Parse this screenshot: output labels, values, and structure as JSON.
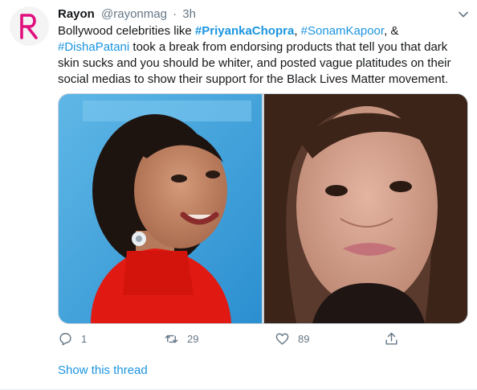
{
  "tweet": {
    "author_name": "Rayon",
    "handle": "@rayonmag",
    "separator": "·",
    "time": "3h",
    "avatar_letter": "R",
    "text": {
      "t1": "Bollywood celebrities like ",
      "tag1": "#PriyankaChopra",
      "t2": ", ",
      "tag2": "#SonamKapoor",
      "t3": ", & ",
      "tag3": "#DishaPatani",
      "t4": " took a break from endorsing products that tell you that dark skin sucks and you should be whiter, and posted vague platitudes on their social medias to show their support for the Black Lives Matter movement."
    },
    "media": [
      {
        "icon": "photo-woman-red-dress"
      },
      {
        "icon": "photo-woman-selfie"
      }
    ],
    "actions": {
      "reply_count": "1",
      "retweet_count": "29",
      "like_count": "89"
    },
    "show_thread": "Show this thread"
  },
  "colors": {
    "brand": "#e0117f",
    "link": "#1b95e0",
    "muted": "#657786"
  }
}
